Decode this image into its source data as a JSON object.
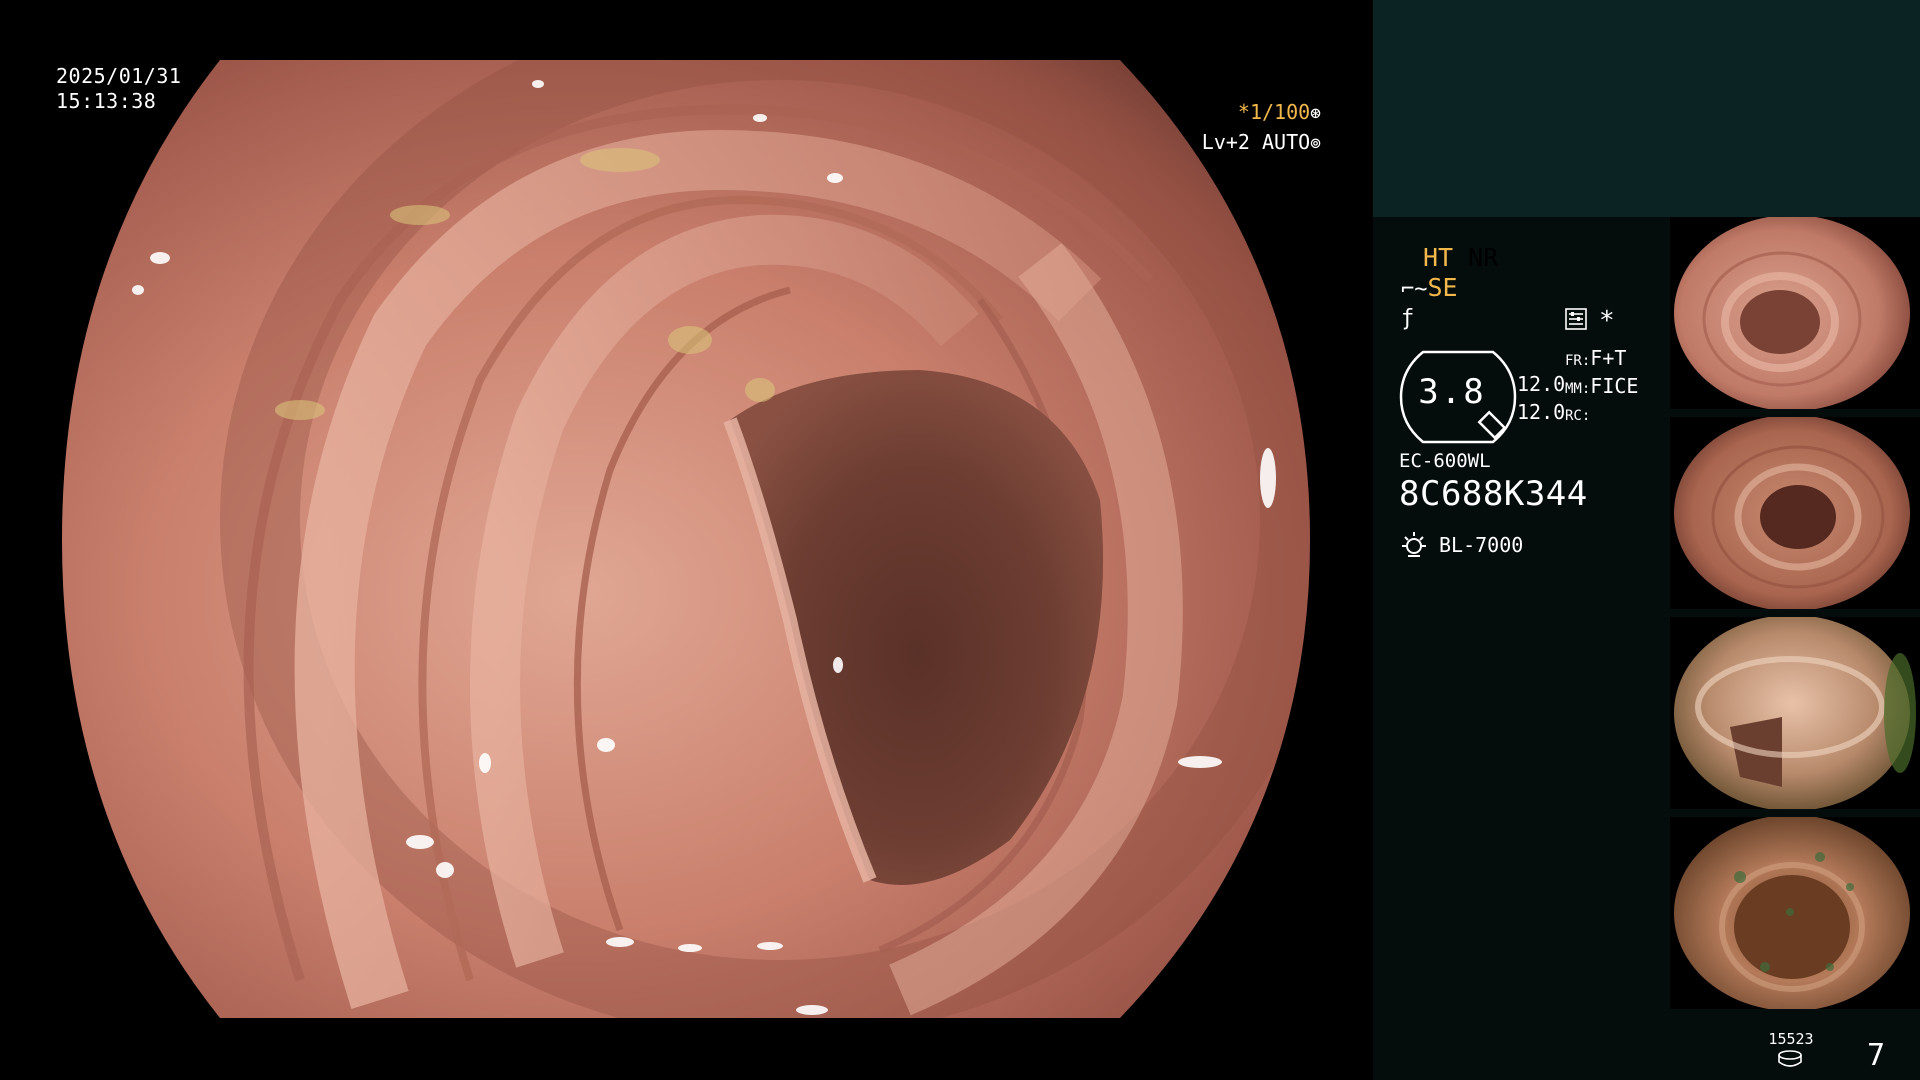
{
  "overlay": {
    "date": "2025/01/31",
    "time": "15:13:38",
    "shutter": "*1/100",
    "shutter_icon": "aperture-icon",
    "level": "Lv+2 AUTO",
    "level_icon": "auto-iris-icon"
  },
  "status": {
    "ht": "HT",
    "nr": "NR",
    "se": "SE",
    "se_icon": "scope-tip-icon",
    "f_icon": "freeze-icon",
    "menu_icon": "menu-list-icon",
    "star": "*",
    "gauge_value": "3.8",
    "num1": "12.0",
    "num2": "12.0",
    "fr_label": "FR:",
    "fr_value": "F+T",
    "mm_label": "MM:",
    "mm_value": "FICE",
    "rc_label": "RC:",
    "model": "EC-600WL",
    "serial": "8C688K344",
    "light_source": "BL-7000",
    "light_icon": "lamp-icon"
  },
  "footer": {
    "count": "15523",
    "count_icon": "storage-disk-icon",
    "page": "7"
  },
  "colors": {
    "accent": "#f2b84b",
    "panel_top": "#0b2323",
    "panel": "#050c0c",
    "tissue": "#c7806e"
  },
  "thumbnails": [
    {
      "name": "capture-1"
    },
    {
      "name": "capture-2"
    },
    {
      "name": "capture-3"
    },
    {
      "name": "capture-4"
    }
  ]
}
